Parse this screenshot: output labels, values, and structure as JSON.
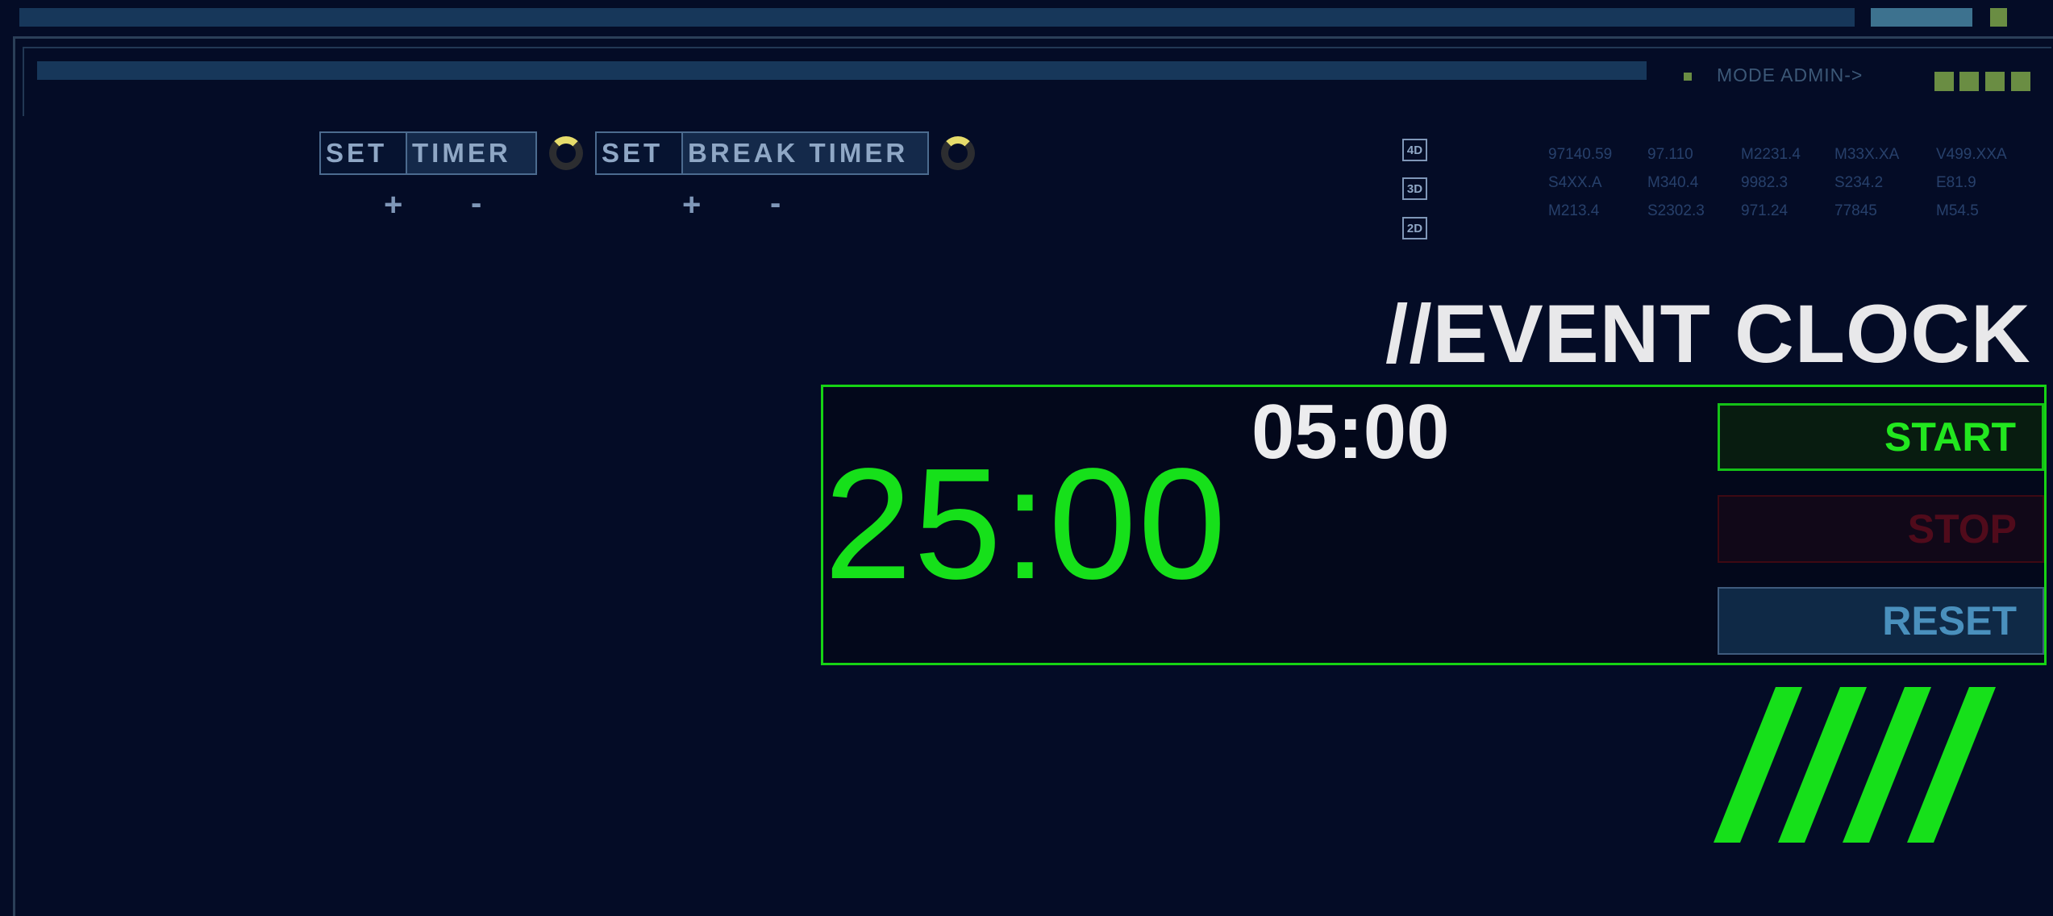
{
  "header": {
    "mode_label": "MODE ADMIN->"
  },
  "controls": {
    "timer": {
      "set_label": "SET",
      "name_label": "TIMER",
      "plus": "+",
      "minus": "-"
    },
    "break_timer": {
      "set_label": "SET",
      "name_label": "BREAK TIMER",
      "plus": "+",
      "minus": "-"
    }
  },
  "dimensions": [
    "4D",
    "3D",
    "2D"
  ],
  "codes": [
    [
      "97140.59",
      "97.110",
      "M2231.4",
      "M33X.XA",
      "V499.XXA"
    ],
    [
      "S4XX.A",
      "M340.4",
      "9982.3",
      "S234.2",
      "E81.9"
    ],
    [
      "M213.4",
      "S2302.3",
      "971.24",
      "77845",
      "M54.5"
    ]
  ],
  "clock": {
    "title": "//EVENT CLOCK",
    "main_time": "25:00",
    "break_time": "05:00",
    "start_label": "START",
    "stop_label": "STOP",
    "reset_label": "RESET"
  },
  "colors": {
    "background": "#040c26",
    "accent_green": "#16e01a",
    "stop_red": "#500b1b",
    "reset_blue": "#4a90bd",
    "knob_yellow": "#e6dc6b"
  }
}
